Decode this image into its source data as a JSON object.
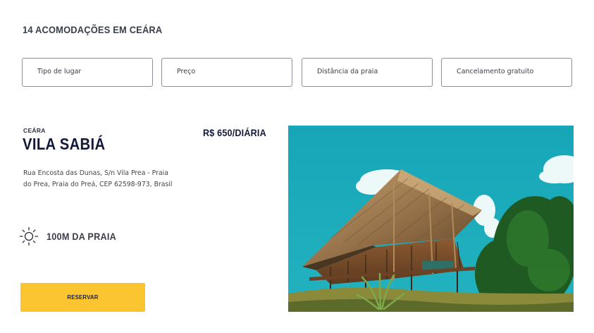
{
  "heading": "14 ACOMODAÇÕES EM CEÁRA",
  "filters": {
    "type": "Tipo de lugar",
    "price": "Preço",
    "distance": "Distância da praia",
    "cancellation": "Cancelamento gratuito"
  },
  "listing": {
    "region": "CEÁRA",
    "title": "VILA SABIÁ",
    "price": "R$ 650/DIÁRIA",
    "address": "Rua Encosta das Dunas, S/n Vila Prea - Praia do Prea, Praia do Preá, CEP 62598-973, Brasil",
    "beach_distance": "100M DA PRAIA",
    "reserve_label": "RESERVAR",
    "beach_icon": "sun-icon",
    "photo": "thatched-roof-house-photo"
  },
  "colors": {
    "accent_button": "#fbc531",
    "title": "#12193a",
    "sky": "#1aa3b5"
  }
}
